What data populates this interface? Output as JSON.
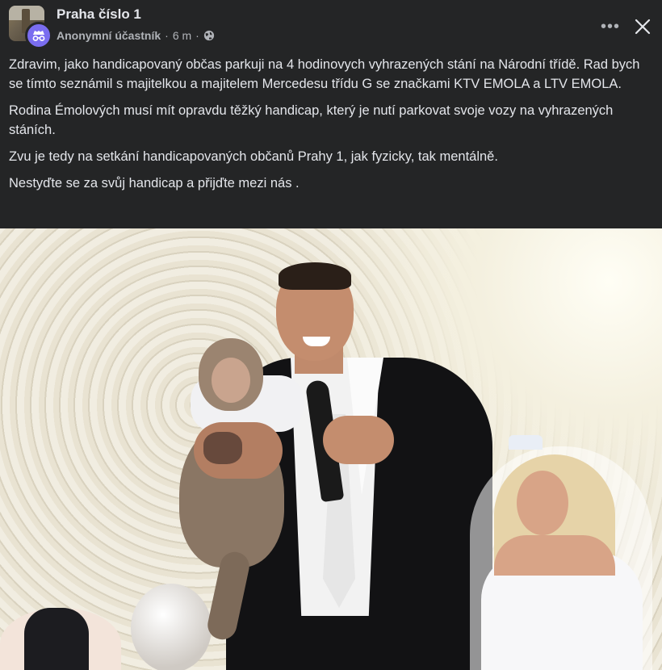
{
  "header": {
    "group_name": "Praha číslo 1",
    "author": "Anonymní účastník",
    "separator": "·",
    "time": "6 m",
    "more_label": "•••"
  },
  "post": {
    "paragraphs": [
      "Zdravim, jako handicapovaný občas parkuji na 4 hodinovych vyhrazených stání na Národní třídě. Rad bych se tímto seznámil s majitelkou a majitelem Mercedesu třídu G se značkami KTV EMOLA a LTV EMOLA.",
      "Rodina Émolových musí mít opravdu těžký handicap, který je nutí parkovat svoje vozy na vyhrazených stáních.",
      "Zvu je tedy na setkání handicapovaných občanů Prahy 1, jak fyzicky, tak mentálně.",
      "Nestyďte se za svůj handicap a přijďte mezi nás ."
    ]
  },
  "icons": {
    "avatar_badge": "incognito-icon",
    "privacy": "globe-icon",
    "more": "more-horizontal-icon",
    "close": "close-icon"
  },
  "colors": {
    "background": "#242526",
    "text_primary": "#e4e6eb",
    "text_secondary": "#b0b3b8",
    "anon_badge": "#7a6df0"
  }
}
